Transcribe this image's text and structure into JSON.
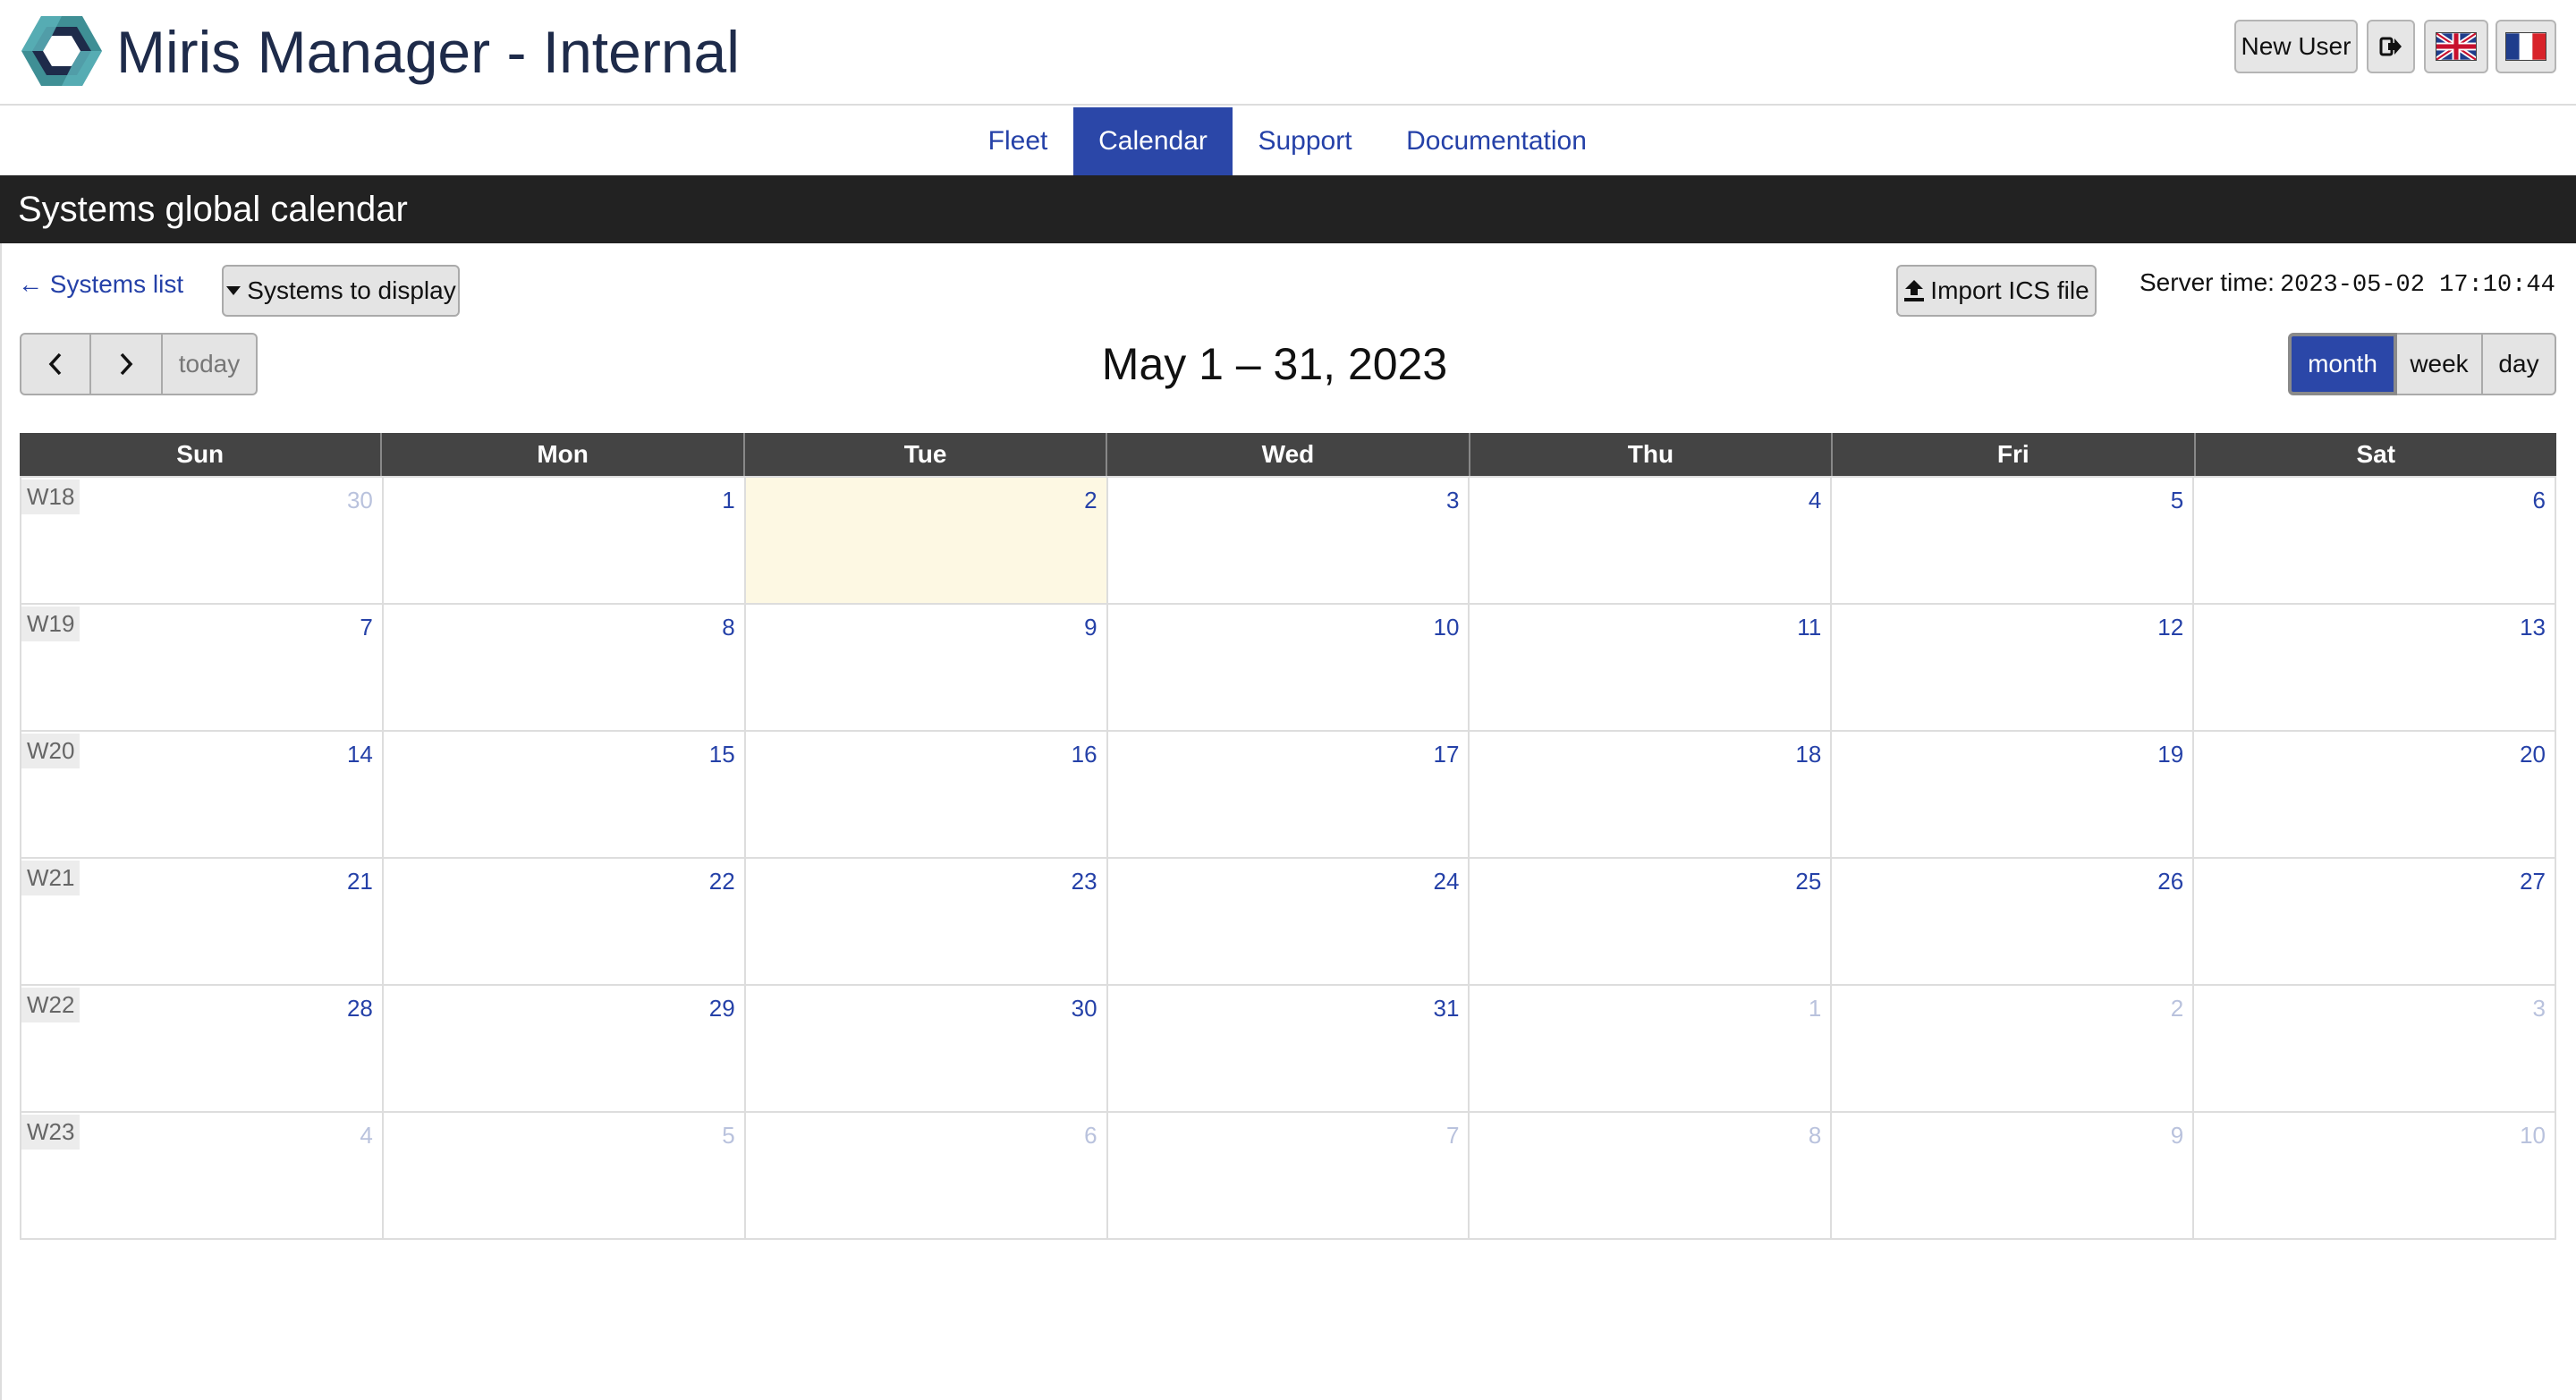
{
  "app": {
    "title": "Miris Manager - Internal"
  },
  "header": {
    "new_user": "New User",
    "icons": {
      "logout": "sign-out-icon",
      "lang_en": "uk-flag-icon",
      "lang_fr": "fr-flag-icon"
    }
  },
  "nav": {
    "tabs": [
      {
        "label": "Fleet",
        "active": false
      },
      {
        "label": "Calendar",
        "active": true
      },
      {
        "label": "Support",
        "active": false
      },
      {
        "label": "Documentation",
        "active": false
      }
    ]
  },
  "page": {
    "title": "Systems global calendar"
  },
  "toolbar": {
    "back_link": "← Systems list",
    "display_button": "Systems to display",
    "import_button": "Import ICS file",
    "server_time_label": "Server time:",
    "server_time_value": "2023-05-02 17:10:44",
    "today": "today",
    "range_title": "May 1 – 31, 2023",
    "views": {
      "month": "month",
      "week": "week",
      "day": "day"
    },
    "active_view": "month"
  },
  "calendar": {
    "weekdays": [
      "Sun",
      "Mon",
      "Tue",
      "Wed",
      "Thu",
      "Fri",
      "Sat"
    ],
    "weeks": [
      {
        "label": "W18",
        "days": [
          {
            "n": "30",
            "other": true
          },
          {
            "n": "1"
          },
          {
            "n": "2",
            "today": true
          },
          {
            "n": "3"
          },
          {
            "n": "4"
          },
          {
            "n": "5"
          },
          {
            "n": "6"
          }
        ]
      },
      {
        "label": "W19",
        "days": [
          {
            "n": "7"
          },
          {
            "n": "8"
          },
          {
            "n": "9"
          },
          {
            "n": "10"
          },
          {
            "n": "11"
          },
          {
            "n": "12"
          },
          {
            "n": "13"
          }
        ]
      },
      {
        "label": "W20",
        "days": [
          {
            "n": "14"
          },
          {
            "n": "15"
          },
          {
            "n": "16"
          },
          {
            "n": "17"
          },
          {
            "n": "18"
          },
          {
            "n": "19"
          },
          {
            "n": "20"
          }
        ]
      },
      {
        "label": "W21",
        "days": [
          {
            "n": "21"
          },
          {
            "n": "22"
          },
          {
            "n": "23"
          },
          {
            "n": "24"
          },
          {
            "n": "25"
          },
          {
            "n": "26"
          },
          {
            "n": "27"
          }
        ]
      },
      {
        "label": "W22",
        "days": [
          {
            "n": "28"
          },
          {
            "n": "29"
          },
          {
            "n": "30"
          },
          {
            "n": "31"
          },
          {
            "n": "1",
            "other": true
          },
          {
            "n": "2",
            "other": true
          },
          {
            "n": "3",
            "other": true
          }
        ]
      },
      {
        "label": "W23",
        "days": [
          {
            "n": "4",
            "other": true
          },
          {
            "n": "5",
            "other": true
          },
          {
            "n": "6",
            "other": true
          },
          {
            "n": "7",
            "other": true
          },
          {
            "n": "8",
            "other": true
          },
          {
            "n": "9",
            "other": true
          },
          {
            "n": "10",
            "other": true
          }
        ]
      }
    ]
  },
  "colors": {
    "accent": "#2b47a8",
    "link": "#2541a8",
    "titlebar": "#222222",
    "today_bg": "#fdf8e3"
  }
}
